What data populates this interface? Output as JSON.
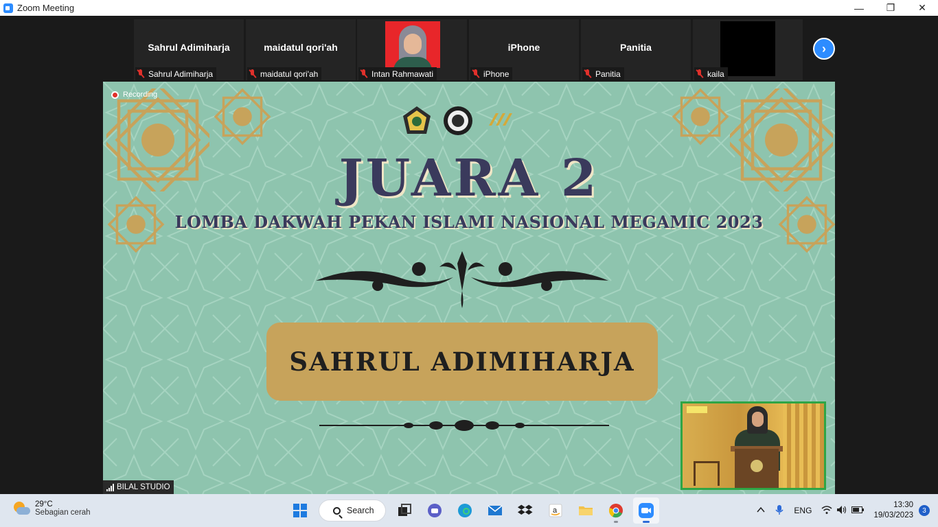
{
  "window": {
    "title": "Zoom Meeting",
    "minimize_glyph": "—",
    "restore_glyph": "❐",
    "close_glyph": "✕"
  },
  "participants": [
    {
      "display_name": "Sahrul Adimiharja",
      "label": "Sahrul Adimiharja",
      "video": "off",
      "muted": true
    },
    {
      "display_name": "maidatul qori'ah",
      "label": "maidatul qori'ah",
      "video": "off",
      "muted": true
    },
    {
      "display_name": "",
      "label": "Intan Rahmawati",
      "video": "on",
      "muted": true
    },
    {
      "display_name": "iPhone",
      "label": "iPhone",
      "video": "off",
      "muted": true
    },
    {
      "display_name": "Panitia",
      "label": "Panitia",
      "video": "off",
      "muted": true
    },
    {
      "display_name": "",
      "label": "kaila",
      "video": "black",
      "muted": true
    }
  ],
  "next_page_glyph": "›",
  "recording": {
    "label": "Recording"
  },
  "share": {
    "headline": "JUARA 2",
    "subtitle": "LOMBA DAKWAH PEKAN ISLAMI NASIONAL MEGAMIC 2023",
    "winner_name": "SAHRUL ADIMIHARJA",
    "bg_color": "#8ec4ae",
    "gold_color": "#c7a35b",
    "text_color": "#3a3a5c"
  },
  "presenter_label": "BILAL STUDIO",
  "taskbar": {
    "weather_temp": "29°C",
    "weather_condition": "Sebagian cerah",
    "search_label": "Search",
    "language": "ENG",
    "time": "13:30",
    "date": "19/03/2023",
    "notification_count": "3",
    "apps": [
      "start-icon",
      "search",
      "task-view-icon",
      "teams-chat-icon",
      "edge-icon",
      "mail-icon",
      "dropbox-icon",
      "amazon-icon",
      "file-explorer-icon",
      "chrome-icon",
      "zoom-icon"
    ]
  }
}
